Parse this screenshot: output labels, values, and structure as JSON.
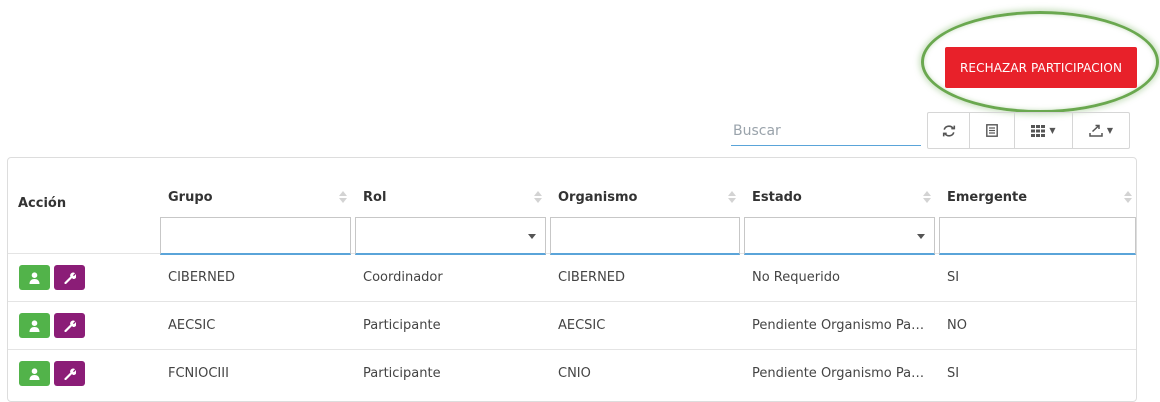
{
  "header": {
    "reject_button_label": "RECHAZAR PARTICIPACION",
    "highlight_color": "#6aa84f",
    "reject_color": "#e8212a"
  },
  "search": {
    "placeholder": "Buscar",
    "value": ""
  },
  "toolbar": {
    "icons": [
      "refresh-icon",
      "toggle-view-icon",
      "columns-icon",
      "export-icon"
    ]
  },
  "table": {
    "columns": [
      "Acción",
      "Grupo",
      "Rol",
      "Organismo",
      "Estado",
      "Emergente"
    ],
    "filters": {
      "grupo": "",
      "rol": "",
      "organismo": "",
      "estado": "",
      "emergente": ""
    },
    "rows": [
      {
        "grupo": "CIBERNED",
        "rol": "Coordinador",
        "organismo": "CIBERNED",
        "estado": "No Requerido",
        "emergente": "SI"
      },
      {
        "grupo": "AECSIC",
        "rol": "Participante",
        "organismo": "AECSIC",
        "estado": "Pendiente Organismo Parti...",
        "emergente": "NO"
      },
      {
        "grupo": "FCNIOCIII",
        "rol": "Participante",
        "organismo": "CNIO",
        "estado": "Pendiente Organismo Parti...",
        "emergente": "SI"
      }
    ],
    "action_icons": [
      "user-icon",
      "wrench-icon"
    ],
    "colors": {
      "user_button": "#52b34a",
      "wrench_button": "#8b1d77"
    }
  }
}
